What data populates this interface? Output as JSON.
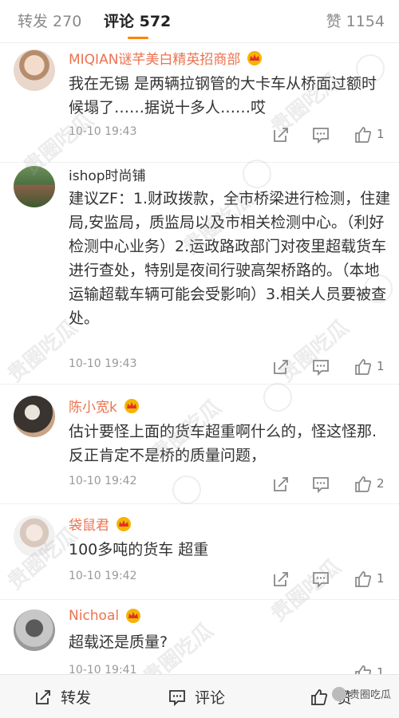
{
  "tabs": {
    "repost": "转发 270",
    "comments": "评论 572",
    "likes": "赞 1154"
  },
  "colors": {
    "accent": "#ff8200",
    "username": "#eb7350",
    "crown": "#f5b400",
    "crown_red": "#e0302b"
  },
  "comments": [
    {
      "username": "MIQIAN谜芊美白精英招商部",
      "text": "我在无锡 是两辆拉钢管的大卡车从桥面过额时候塌了……据说十多人……哎",
      "time": "10-10 19:43",
      "likes": "1",
      "badge": "crown-icon"
    },
    {
      "username": "ishop时尚铺",
      "text": "建议ZF：1.财政拨款，全市桥梁进行检测，住建局,安监局，质监局以及市相关检测中心。（利好检测中心业务）2.运政路政部门对夜里超载货车进行查处，特别是夜间行驶高架桥路的。（本地运输超载车辆可能会受影响）3.相关人员要被查处。",
      "time": "10-10 19:43",
      "likes": "1",
      "badge": ""
    },
    {
      "username": "陈小宽k",
      "text": "估计要怪上面的货车超重啊什么的，怪这怪那.反正肯定不是桥的质量问题，",
      "time": "10-10 19:42",
      "likes": "2",
      "badge": "crown-icon"
    },
    {
      "username": "袋鼠君",
      "text": "100多吨的货车 超重",
      "time": "10-10 19:42",
      "likes": "1",
      "badge": "crown-icon"
    },
    {
      "username": "Nichoal",
      "text": "超载还是质量?",
      "time": "10-10 19:41",
      "likes": "1",
      "badge": "crown-icon"
    }
  ],
  "watermark": "贵圈吃瓜",
  "bottom_bar": {
    "repost": "转发",
    "comment": "评论",
    "like": "赞"
  },
  "wechat_label": "贵圈吃瓜"
}
